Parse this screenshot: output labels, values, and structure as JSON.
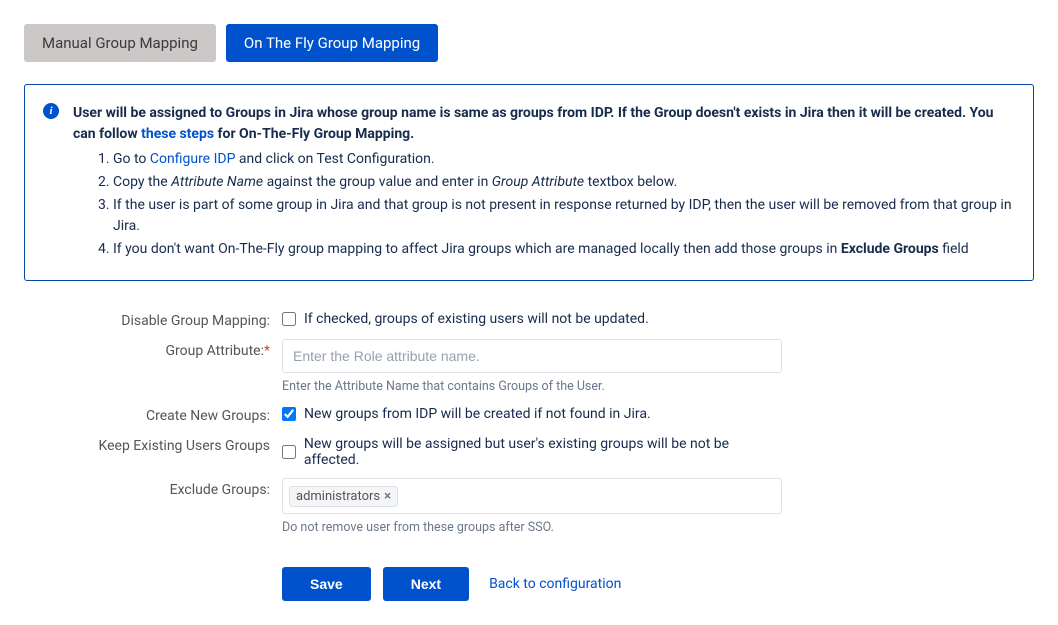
{
  "tabs": {
    "manual": "Manual Group Mapping",
    "onthefly": "On The Fly Group Mapping"
  },
  "info": {
    "heading_part1": "User will be assigned to Groups in Jira whose group name is same as groups from IDP. If the Group doesn't exists in Jira then it will be created. You can follow ",
    "heading_link": "these steps",
    "heading_part2": " for On-The-Fly Group Mapping.",
    "li1_a": "Go to ",
    "li1_link": "Configure IDP",
    "li1_b": " and click on Test Configuration.",
    "li2_a": "Copy the ",
    "li2_em1": "Attribute Name",
    "li2_b": " against the group value and enter in ",
    "li2_em2": "Group Attribute",
    "li2_c": " textbox below.",
    "li3": "If the user is part of some group in Jira and that group is not present in response returned by IDP, then the user will be removed from that group in Jira.",
    "li4_a": "If you don't want On-The-Fly group mapping to affect Jira groups which are managed locally then add those groups in ",
    "li4_bold": "Exclude Groups",
    "li4_b": " field"
  },
  "form": {
    "disable_label": "Disable Group Mapping:",
    "disable_desc": "If checked, groups of existing users will not be updated.",
    "group_attr_label": "Group Attribute:",
    "group_attr_placeholder": "Enter the Role attribute name.",
    "group_attr_help": "Enter the Attribute Name that contains Groups of the User.",
    "create_label": "Create New Groups:",
    "create_desc": "New groups from IDP will be created if not found in Jira.",
    "keep_label": "Keep Existing Users Groups",
    "keep_desc": "New groups will be assigned but user's existing groups will be not be affected.",
    "exclude_label": "Exclude Groups:",
    "exclude_tag": "administrators",
    "exclude_help": "Do not remove user from these groups after SSO."
  },
  "buttons": {
    "save": "Save",
    "next": "Next",
    "back": "Back to configuration"
  }
}
